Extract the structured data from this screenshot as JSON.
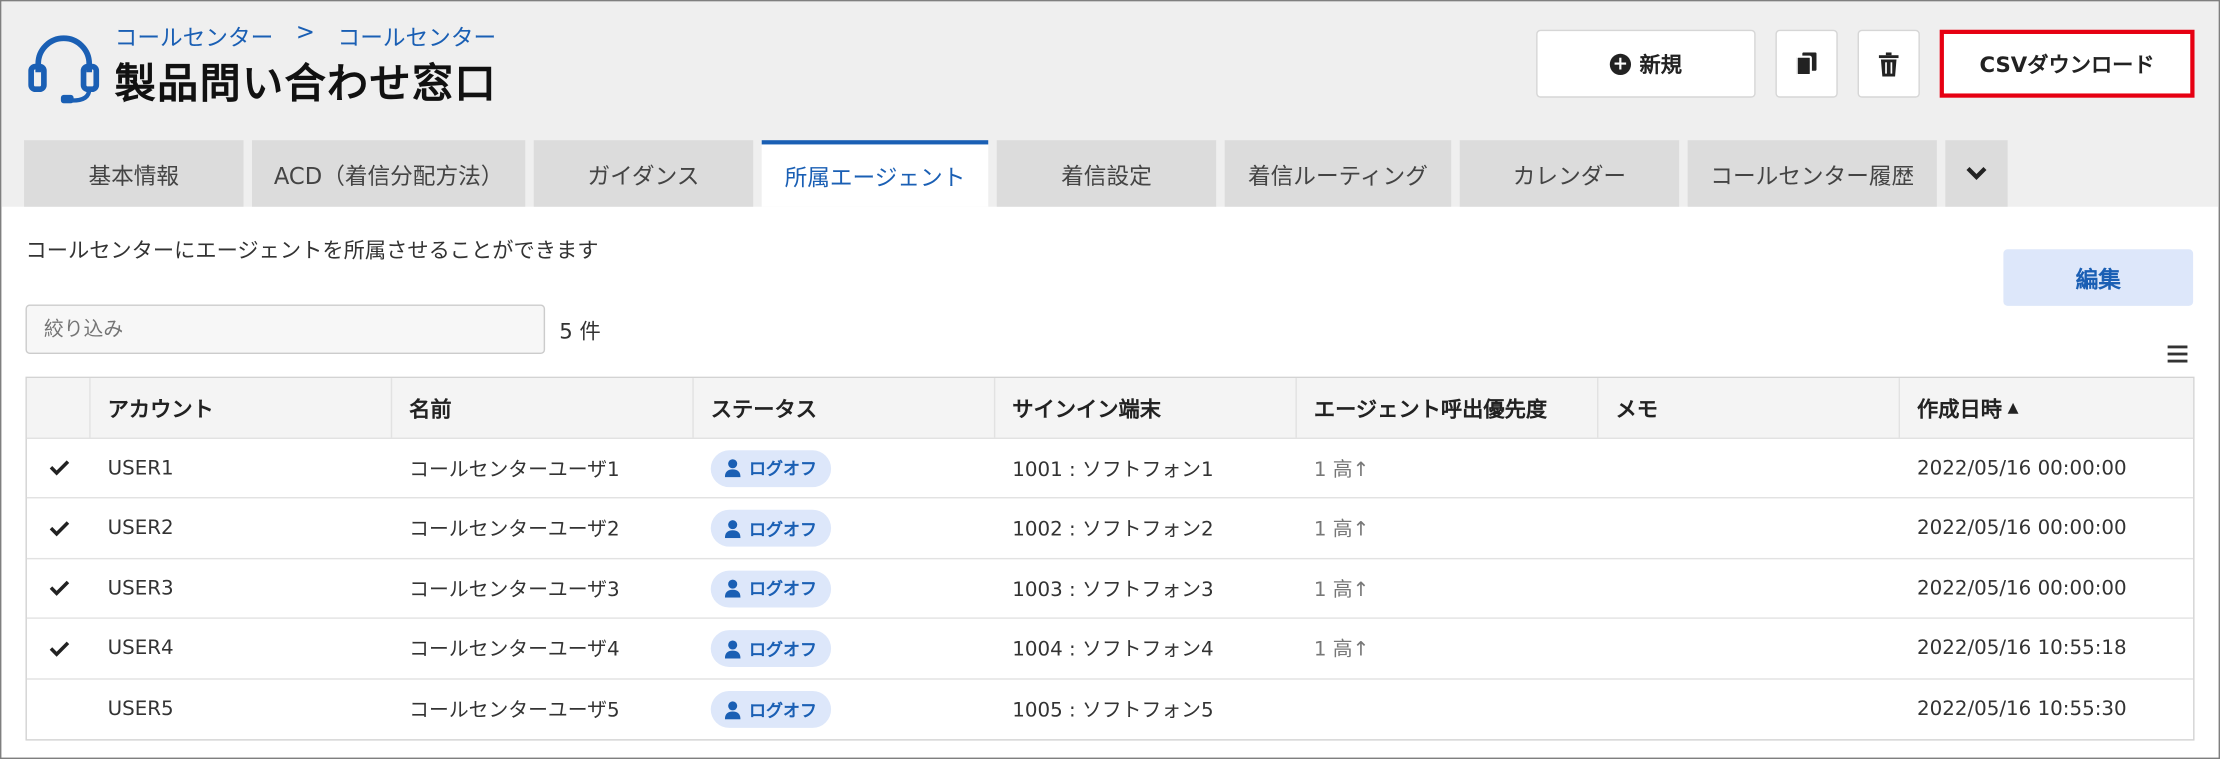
{
  "header": {
    "breadcrumb": [
      "コールセンター",
      "コールセンター"
    ],
    "breadcrumb_separator": ">",
    "title": "製品問い合わせ窓口"
  },
  "actions": {
    "new_label": "新規",
    "csv_label": "CSVダウンロード",
    "copy_icon": "copy-icon",
    "trash_icon": "trash-icon"
  },
  "tabs": [
    {
      "label": "基本情報",
      "active": false
    },
    {
      "label": "ACD（着信分配方法）",
      "active": false
    },
    {
      "label": "ガイダンス",
      "active": false
    },
    {
      "label": "所属エージェント",
      "active": true
    },
    {
      "label": "着信設定",
      "active": false
    },
    {
      "label": "着信ルーティング",
      "active": false
    },
    {
      "label": "カレンダー",
      "active": false
    },
    {
      "label": "コールセンター履歴",
      "active": false
    }
  ],
  "main": {
    "description": "コールセンターにエージェントを所属させることができます",
    "edit_label": "編集",
    "filter_placeholder": "絞り込み",
    "count": "5 件"
  },
  "table": {
    "columns": [
      "",
      "アカウント",
      "名前",
      "ステータス",
      "サインイン端末",
      "エージェント呼出優先度",
      "メモ",
      "作成日時"
    ],
    "sort_column": "作成日時",
    "sort_indicator": "▲",
    "rows": [
      {
        "checked": true,
        "account": "USER1",
        "name": "コールセンターユーザ1",
        "status": "ログオフ",
        "device": "1001 : ソフトフォン1",
        "priority": "1 高↑",
        "memo": "",
        "created": "2022/05/16 00:00:00"
      },
      {
        "checked": true,
        "account": "USER2",
        "name": "コールセンターユーザ2",
        "status": "ログオフ",
        "device": "1002 : ソフトフォン2",
        "priority": "1 高↑",
        "memo": "",
        "created": "2022/05/16 00:00:00"
      },
      {
        "checked": true,
        "account": "USER3",
        "name": "コールセンターユーザ3",
        "status": "ログオフ",
        "device": "1003 : ソフトフォン3",
        "priority": "1 高↑",
        "memo": "",
        "created": "2022/05/16 00:00:00"
      },
      {
        "checked": true,
        "account": "USER4",
        "name": "コールセンターユーザ4",
        "status": "ログオフ",
        "device": "1004 : ソフトフォン4",
        "priority": "1 高↑",
        "memo": "",
        "created": "2022/05/16 10:55:18"
      },
      {
        "checked": false,
        "account": "USER5",
        "name": "コールセンターユーザ5",
        "status": "ログオフ",
        "device": "1005 : ソフトフォン5",
        "priority": "",
        "memo": "",
        "created": "2022/05/16 10:55:30"
      }
    ]
  },
  "colors": {
    "accent": "#1a5fb4",
    "highlight_border": "#e60012",
    "badge_bg": "#dde7fa"
  }
}
